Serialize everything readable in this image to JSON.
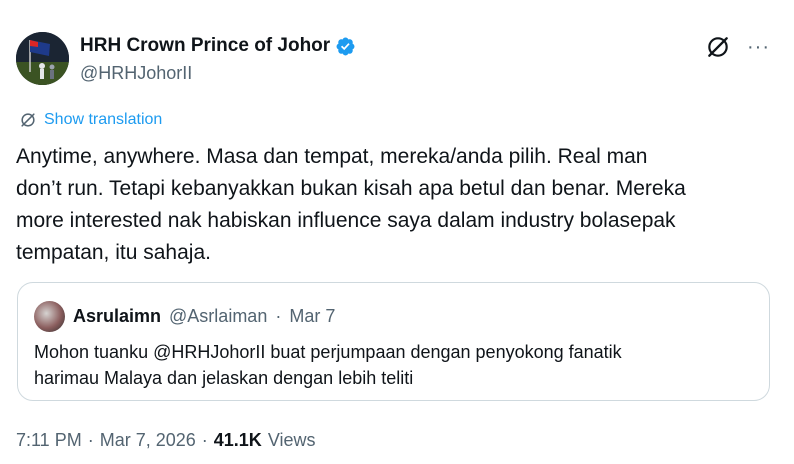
{
  "author": {
    "display_name": "HRH Crown Prince of Johor",
    "handle": "@HRHJohorII",
    "verified_color": "#1d9bf0"
  },
  "top_actions": {
    "grok_icon": "grok-icon",
    "more_label": "···"
  },
  "translation": {
    "label": "Show translation",
    "icon": "translate-icon"
  },
  "tweet": {
    "lines": [
      "Anytime, anywhere. Masa dan tempat, mereka/anda pilih. Real man",
      "don’t run. Tetapi kebanyakkan bukan kisah apa betul dan benar. Mereka",
      "more interested nak habiskan influence saya dalam industry bolasepak",
      "tempatan, itu sahaja."
    ]
  },
  "quote": {
    "name": "Asrulaimn",
    "handle": "@Asrlaiman",
    "dot": "·",
    "date": "Mar 7",
    "lines": [
      "Mohon tuanku @HRHJohorII buat perjumpaan dengan penyokong fanatik",
      "harimau Malaya dan jelaskan dengan lebih teliti"
    ]
  },
  "meta": {
    "time": "7:11 PM",
    "sep1": "·",
    "date": "Mar 7, 2026",
    "sep2": "·",
    "views_count": "41.1K",
    "views_label": "Views"
  },
  "colors": {
    "link": "#1d9bf0",
    "text": "#0f1419",
    "secondary": "#536471",
    "border": "#cfd9de"
  }
}
